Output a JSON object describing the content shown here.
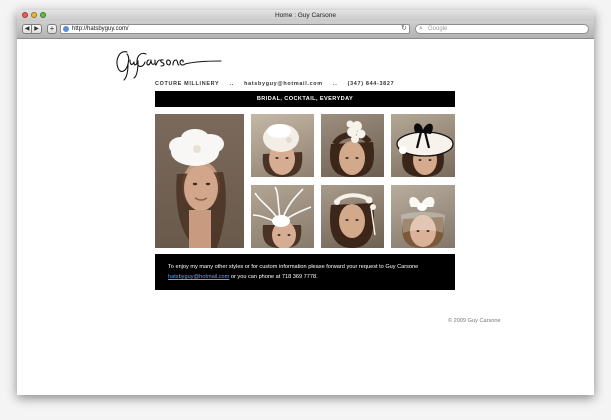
{
  "browser": {
    "window_title": "Home : Guy Carsone",
    "url": "http://hatsbyguy.com/",
    "search_placeholder": "Google",
    "back_glyph": "◀",
    "forward_glyph": "▶",
    "add_glyph": "+",
    "reload_glyph": "↻",
    "search_glyph": "⌕"
  },
  "header": {
    "logo_signature": "Guy Carsone",
    "tagline": "COTURE MILLINERY",
    "separator": "..",
    "email": "hatsbyguy@hotmail.com",
    "phone": "(347) 844-3827"
  },
  "nav": {
    "label": "BRIDAL, COCKTAIL, EVERYDAY"
  },
  "gallery": {
    "items": [
      {
        "icon": "white-feather-fascinator-photo"
      },
      {
        "icon": "white-pillbox-hat-photo"
      },
      {
        "icon": "white-flower-headpiece-photo"
      },
      {
        "icon": "black-bow-hat-photo"
      },
      {
        "icon": "white-feather-headpiece-photo"
      },
      {
        "icon": "floral-headband-photo"
      },
      {
        "icon": "white-bow-veil-photo"
      }
    ]
  },
  "info": {
    "line1": "To enjoy my many other styles or for custom information please forward your request to Guy Carsone",
    "link": "hatsbyguy@hotmail.com",
    "line2_rest": " or you can phone at 718 369 7778."
  },
  "footer": {
    "copyright": "© 2009 Guy Carsone"
  },
  "colors": {
    "banner": "#000000",
    "link": "#5aa7ff",
    "page": "#ffffff"
  }
}
